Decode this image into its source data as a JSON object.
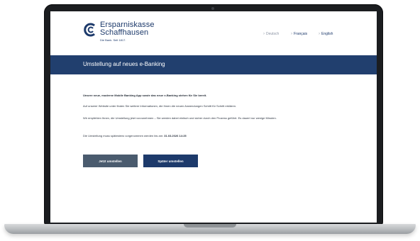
{
  "brand": {
    "name_line1": "Ersparniskasse",
    "name_line2": "Schaffhausen",
    "tagline": "Die Bank. Seit 1817."
  },
  "languages": [
    {
      "label": "Deutsch",
      "active": false
    },
    {
      "label": "Français",
      "active": true
    },
    {
      "label": "English",
      "active": true
    }
  ],
  "banner": {
    "title": "Umstellung auf neues e-Banking"
  },
  "content": {
    "headline": "Unsere neue, moderne Mobile Banking App sowie das neue e-Banking stehen für Sie bereit.",
    "info": "Auf unserer Website unter finden Sie weitere Informationen, die Ihnen die neuen Anwendungen Schritt für Schritt erklären.",
    "recommend": "Wir empfehlen Ihnen, die Umstellung jetzt vorzunehmen – Sie werden dabei einfach und sicher durch den Prozess geführt. Es dauert nur wenige Minuten.",
    "deadline_prefix": "Die Umstellung muss spätestens vorgenommen werden bis am:",
    "deadline_date": "31.03.2026 14:25"
  },
  "buttons": {
    "now": "Jetzt umstellen",
    "later": "Später umstellen"
  },
  "colors": {
    "brand": "#1d3a6b",
    "banner": "#213f6e",
    "secondary_button": "#4a5b6e"
  }
}
